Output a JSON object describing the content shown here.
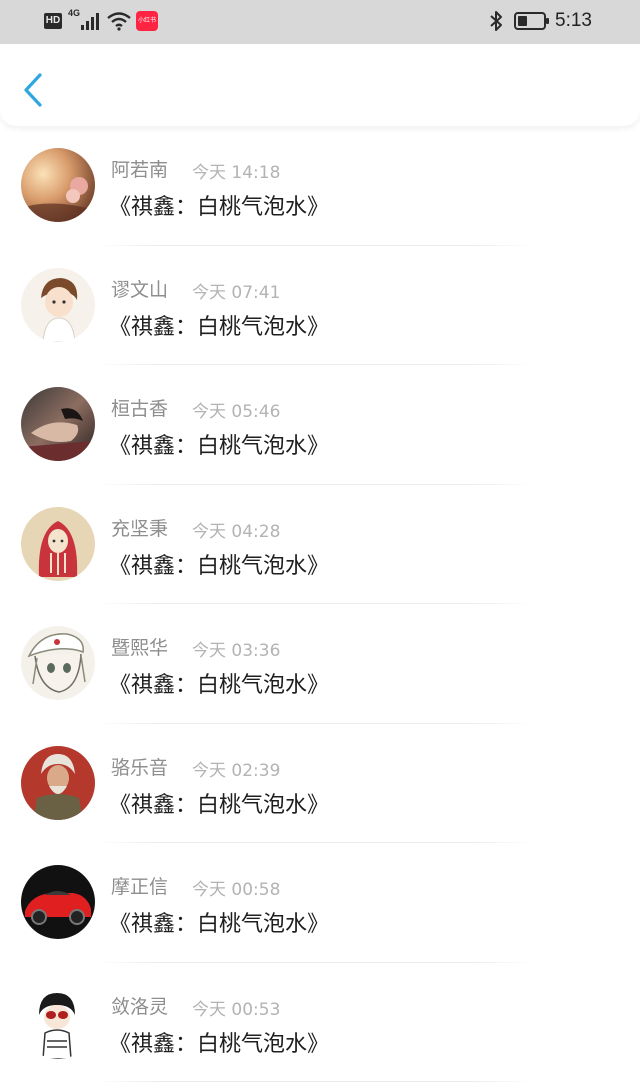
{
  "status_bar": {
    "hd": "HD",
    "network": "4G",
    "app_badge": "小红书",
    "time": "5:13"
  },
  "header": {
    "back_icon": "chevron-left-icon",
    "accent_color": "#2ea7e0"
  },
  "list": {
    "items": [
      {
        "name": "阿若南",
        "time": "今天 14:18",
        "title": "《祺鑫：白桃气泡水》"
      },
      {
        "name": "谬文山",
        "time": "今天 07:41",
        "title": "《祺鑫：白桃气泡水》"
      },
      {
        "name": "桓古香",
        "time": "今天 05:46",
        "title": "《祺鑫：白桃气泡水》"
      },
      {
        "name": "充坚秉",
        "time": "今天 04:28",
        "title": "《祺鑫：白桃气泡水》"
      },
      {
        "name": "暨熙华",
        "time": "今天 03:36",
        "title": "《祺鑫：白桃气泡水》"
      },
      {
        "name": "骆乐音",
        "time": "今天 02:39",
        "title": "《祺鑫：白桃气泡水》"
      },
      {
        "name": "摩正信",
        "time": "今天 00:58",
        "title": "《祺鑫：白桃气泡水》"
      },
      {
        "name": "敛洛灵",
        "time": "今天 00:53",
        "title": "《祺鑫：白桃气泡水》"
      }
    ]
  }
}
